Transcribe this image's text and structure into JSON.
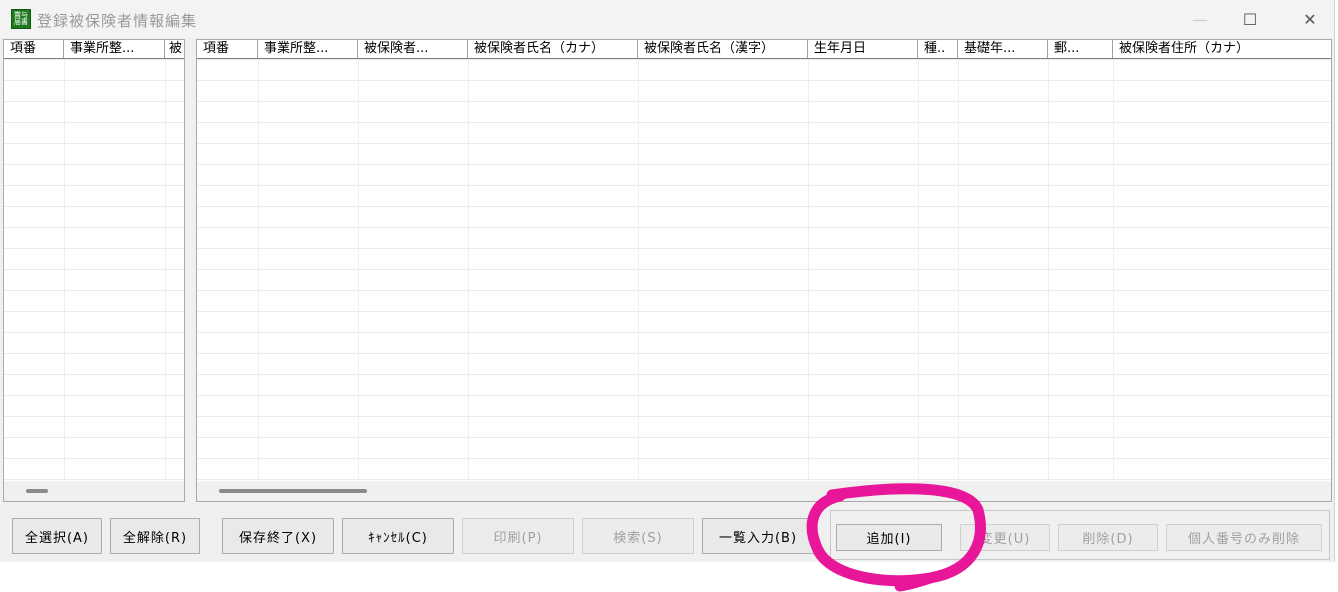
{
  "window": {
    "title": "登録被保険者情報編集",
    "icon_text": "賞与 届書",
    "maximize_glyph": "☐",
    "close_glyph": "✕"
  },
  "left_grid": {
    "columns": [
      "項番",
      "事業所整...",
      "被"
    ]
  },
  "main_grid": {
    "columns": [
      "項番",
      "事業所整...",
      "被保険者...",
      "被保険者氏名（カナ）",
      "被保険者氏名（漢字）",
      "生年月日",
      "種..",
      "基礎年...",
      "郵...",
      "被保険者住所（カナ）"
    ]
  },
  "buttons": {
    "select_all": "全選択(A)",
    "deselect_all": "全解除(R)",
    "save_exit": "保存終了(X)",
    "cancel": "ｷｬﾝｾﾙ(C)",
    "print": "印刷(P)",
    "search": "検索(S)",
    "list_input": "一覧入力(B)",
    "add": "追加(I)",
    "change": "変更(U)",
    "delete": "削除(D)",
    "delete_my_number": "個人番号のみ削除"
  },
  "annotation": {
    "color": "#e8179a"
  }
}
